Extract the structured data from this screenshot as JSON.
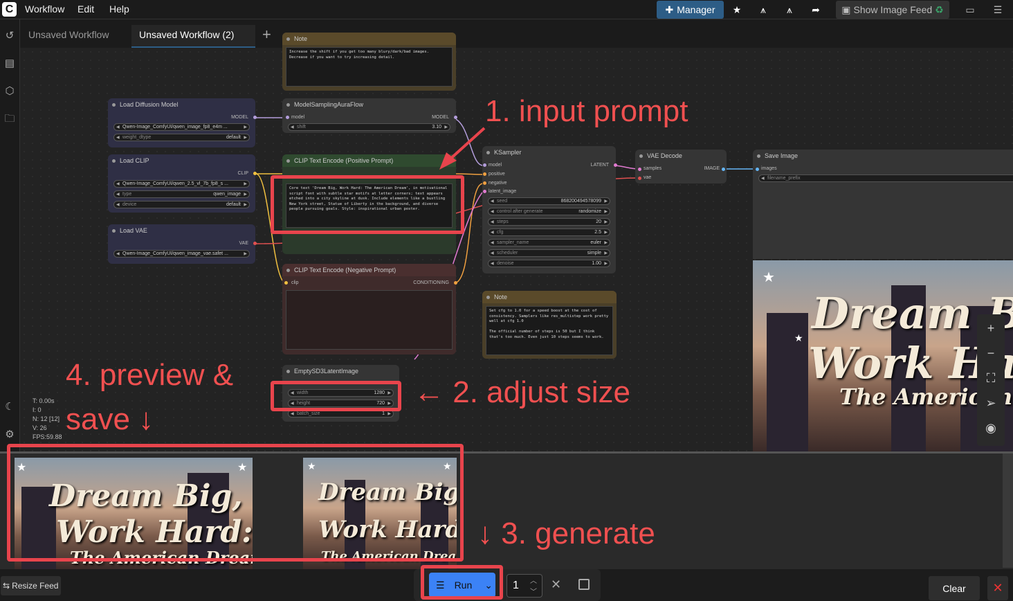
{
  "topbar": {
    "menus": [
      "Workflow",
      "Edit",
      "Help"
    ],
    "manager_label": "Manager",
    "image_feed_label": "Show Image Feed"
  },
  "tabs": [
    "Unsaved Workflow",
    "Unsaved Workflow (2)"
  ],
  "nodes": {
    "note_top": {
      "title": "Note",
      "text": "Increase the shift if you get too many blury/dark/bad images. Decrease if you want to try increasing detail."
    },
    "load_diffusion": {
      "title": "Load Diffusion Model",
      "output": "MODEL",
      "unet_name": "Qwen-Image_ComfyUI/qwen_image_fp8_e4m ...",
      "weight_dtype_label": "weight_dtype",
      "weight_dtype": "default"
    },
    "model_sampling": {
      "title": "ModelSamplingAuraFlow",
      "input": "model",
      "output": "MODEL",
      "shift_label": "shift",
      "shift": "3.10"
    },
    "load_clip": {
      "title": "Load CLIP",
      "output": "CLIP",
      "clip_name": "Qwen-Image_ComfyUI/qwen_2.5_vl_7b_fp8_s ...",
      "type_label": "type",
      "type": "qwen_image",
      "device_label": "device",
      "device": "default"
    },
    "clip_pos": {
      "title": "CLIP Text Encode (Positive Prompt)",
      "input": "clip",
      "output": "CONDITIONING",
      "text": "Core text 'Dream Big, Work Hard: The American Dream', in motivational script font with subtle star motifs at letter corners; text appears etched into a city skyline at dusk. Include elements like a bustling New York street, Statue of Liberty in the background, and diverse people pursuing goals. Style: inspirational urban poster."
    },
    "load_vae": {
      "title": "Load VAE",
      "output": "VAE",
      "vae_name": "Qwen-Image_ComfyUI/qwen_image_vae.safet ..."
    },
    "clip_neg": {
      "title": "CLIP Text Encode (Negative Prompt)",
      "input": "clip",
      "output": "CONDITIONING"
    },
    "ksampler": {
      "title": "KSampler",
      "inputs": [
        "model",
        "positive",
        "negative",
        "latent_image"
      ],
      "output": "LATENT",
      "widgets": [
        {
          "label": "seed",
          "value": "868200494578099"
        },
        {
          "label": "control after generate",
          "value": "randomize"
        },
        {
          "label": "steps",
          "value": "20"
        },
        {
          "label": "cfg",
          "value": "2.5"
        },
        {
          "label": "sampler_name",
          "value": "euler"
        },
        {
          "label": "scheduler",
          "value": "simple"
        },
        {
          "label": "denoise",
          "value": "1.00"
        }
      ]
    },
    "vae_decode": {
      "title": "VAE Decode",
      "inputs": [
        "samples",
        "vae"
      ],
      "output": "IMAGE"
    },
    "save_image": {
      "title": "Save Image",
      "input": "images",
      "prefix_label": "filename_prefix"
    },
    "note_bottom": {
      "title": "Note",
      "text": "Set cfg to 1.0 for a speed boost at the cost of consistency. Samplers like res_multistep work pretty well at cfg 1.0\n\nThe official number of steps is 50 but I think that's too much. Even just 10 steps seems to work."
    },
    "empty_latent": {
      "title": "EmptySD3LatentImage",
      "widgets": [
        {
          "label": "width",
          "value": "1280"
        },
        {
          "label": "height",
          "value": "720"
        },
        {
          "label": "batch_size",
          "value": "1"
        }
      ]
    }
  },
  "annotations": {
    "step1": "1. input prompt",
    "step2": "← 2. adjust size",
    "step3": "↓ 3. generate",
    "step4_line1": "4. preview &",
    "step4_line2": "save ↓"
  },
  "stats": [
    "T: 0.00s",
    "I: 0",
    "N: 12 [12]",
    "V: 26",
    "FPS:59.88"
  ],
  "poster": {
    "line1": "Dream Big,",
    "line2": "Work Hard:",
    "line3": "The American Dream"
  },
  "bottombar": {
    "resize_feed": "Resize Feed",
    "run_label": "Run",
    "batch_count": "1",
    "clear_label": "Clear"
  },
  "colors": {
    "accent": "#2d5d86",
    "annotation_red": "#e8444c",
    "run_blue": "#3b82f6"
  }
}
